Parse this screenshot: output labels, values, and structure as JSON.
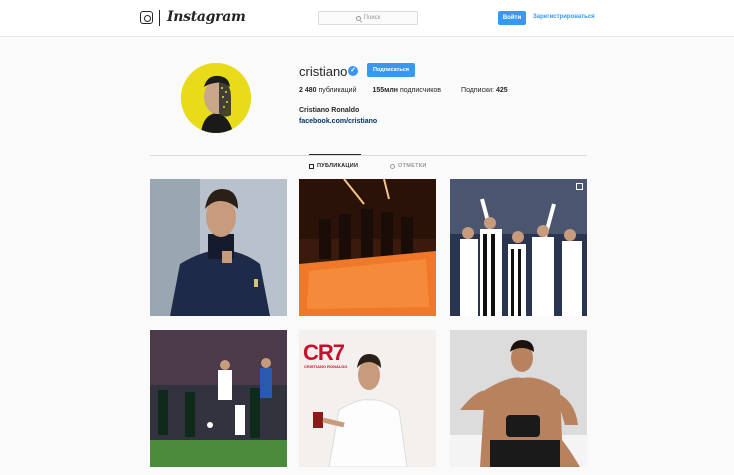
{
  "header": {
    "brand": "Instagram",
    "search_placeholder": "Поиск",
    "login_label": "Войти",
    "signup_label": "Зарегистрироваться"
  },
  "profile": {
    "username": "cristiano",
    "verified": true,
    "follow_label": "Подписаться",
    "posts_count": "2 480",
    "posts_label": "публикаций",
    "followers_count": "155млн",
    "followers_label": "подписчиков",
    "following_label": "Подписки:",
    "following_count": "425",
    "full_name": "Cristiano Ronaldo",
    "link": "facebook.com/cristiano"
  },
  "tabs": [
    {
      "label": "ПУБЛИКАЦИИ",
      "active": true,
      "icon": "grid-icon"
    },
    {
      "label": "ОТМЕТКИ",
      "active": false,
      "icon": "tag-icon"
    }
  ],
  "posts": [
    {
      "alt_icon": "photo",
      "multi": false
    },
    {
      "alt_icon": "photo",
      "multi": false
    },
    {
      "alt_icon": "photo",
      "multi": true
    },
    {
      "alt_icon": "photo",
      "multi": false
    },
    {
      "alt_icon": "photo",
      "multi": false,
      "brand_text": "CR7",
      "brand_sub": "CRISTIANO RONALDO"
    },
    {
      "alt_icon": "photo",
      "multi": false
    }
  ],
  "colors": {
    "accent": "#3897f0",
    "background": "#fafafa",
    "avatar_bg": "#e8dc1a",
    "cr7_red": "#c8102e"
  }
}
